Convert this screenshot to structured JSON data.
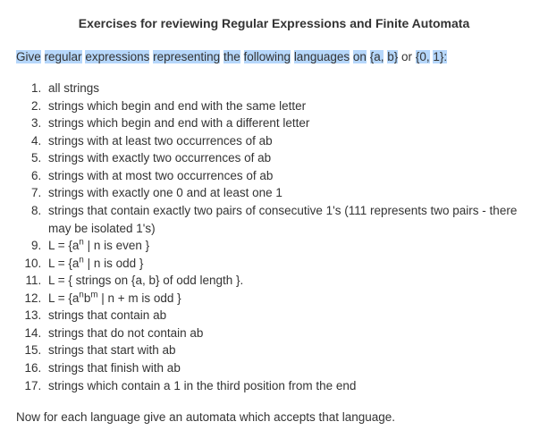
{
  "title": "Exercises for reviewing Regular Expressions and Finite Automata",
  "instruction": {
    "w1": "Give",
    "w2": "regular",
    "w3": "expressions",
    "w4": "representing",
    "w5": "the",
    "w6": "following",
    "w7": "languages",
    "w8": "on",
    "w9": "{a,",
    "w10": "b}",
    "w11": "or",
    "w12": "{0,",
    "w13": "1}:"
  },
  "items": {
    "i1": "all strings",
    "i2": "strings which begin and end with the same letter",
    "i3": "strings which begin and end with a different letter",
    "i4": "strings with at least two occurrences of ab",
    "i5": "strings with exactly two occurrences of ab",
    "i6": "strings with at most two occurrences of ab",
    "i7": "strings with exactly one 0 and at least one 1",
    "i8": "strings that contain exactly two pairs of consecutive 1's (111 represents two pairs - there may be isolated 1's)",
    "i9_pre": "L = {a",
    "i9_sup": "n",
    "i9_post": " | n is even }",
    "i10_pre": "L = {a",
    "i10_sup": "n",
    "i10_post": " | n is odd }",
    "i11": "L = { strings on {a, b} of odd length }.",
    "i12_pre": "L = {a",
    "i12_sup1": "n",
    "i12_mid": "b",
    "i12_sup2": "m",
    "i12_post": " | n + m is odd }",
    "i13": "strings that contain ab",
    "i14": "strings that do not contain ab",
    "i15": "strings that start with ab",
    "i16": "strings that finish with ab",
    "i17": "strings which contain a 1 in the third position from the end"
  },
  "closing": "Now for each language give an automata which accepts that language."
}
